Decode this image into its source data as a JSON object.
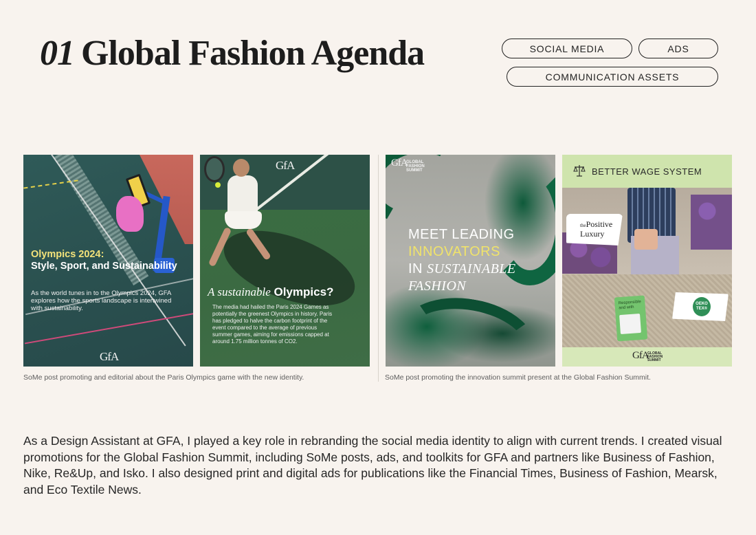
{
  "header": {
    "number": "01",
    "title": "Global Fashion Agenda"
  },
  "tags": [
    {
      "label": "SOCIAL MEDIA"
    },
    {
      "label": "ADS"
    },
    {
      "label": "COMMUNICATION ASSETS"
    }
  ],
  "cards": {
    "card1": {
      "headline_accent": "Olympics 2024:",
      "headline_rest": "Style, Sport, and Sustainability",
      "body": "As the world tunes in to the Olympics 2024, GFA explores how the sports landscape is intertwined with sustainability.",
      "logo": "GfA"
    },
    "card2": {
      "logo": "GfA",
      "headline_italic": "A sustainable",
      "headline_bold": "Olympics?",
      "body": "The media had hailed the Paris 2024 Games as potentially the greenest Olympics in history. Paris has pledged to halve the carbon footprint of the event compared to the average of previous summer games, aiming for emissions capped at around 1.75 million tonnes of CO2."
    },
    "card3": {
      "logo": "GfA",
      "logo_sub_1": "GLOBAL",
      "logo_sub_2": "FASHION",
      "logo_sub_3": "SUMMIT",
      "line1": "MEET LEADING",
      "line2": "INNOVATORS",
      "line3_prefix": "IN",
      "line3_serif": "SUSTAINABLE",
      "line4_serif": "FASHION"
    },
    "card4": {
      "title": "BETTER WAGE SYSTEM",
      "pl_small": "the",
      "pl_line1": "Positive",
      "pl_line2": "Luxury",
      "tag_text_1": "Responsible",
      "tag_text_2": "and with",
      "oeko_1": "OEKO",
      "oeko_2": "TEX®",
      "logo": "GfA",
      "logo_sub_1": "GLOBAL",
      "logo_sub_2": "FASHION",
      "logo_sub_3": "SUMMIT"
    }
  },
  "captions": {
    "left": "SoMe post promoting and editorial about the Paris Olympics game with the new identity.",
    "right": "SoMe post promoting the innovation summit present at the Global Fashion Summit."
  },
  "paragraph": "As a Design Assistant at GFA, I played a key role in rebranding the social media identity to align with current trends. I created visual promotions for the Global Fashion Summit, including SoMe posts, ads, and toolkits for GFA and partners like Business of Fashion, Nike, Re&Up, and Isko. I also designed print and digital ads for publications like the Financial Times, Business of Fashion, Mearsk, and Eco Textile News.",
  "colors": {
    "background": "#f8f3ee",
    "card4_green": "#d7e8b9",
    "accent_yellow": "#f0e36b"
  }
}
